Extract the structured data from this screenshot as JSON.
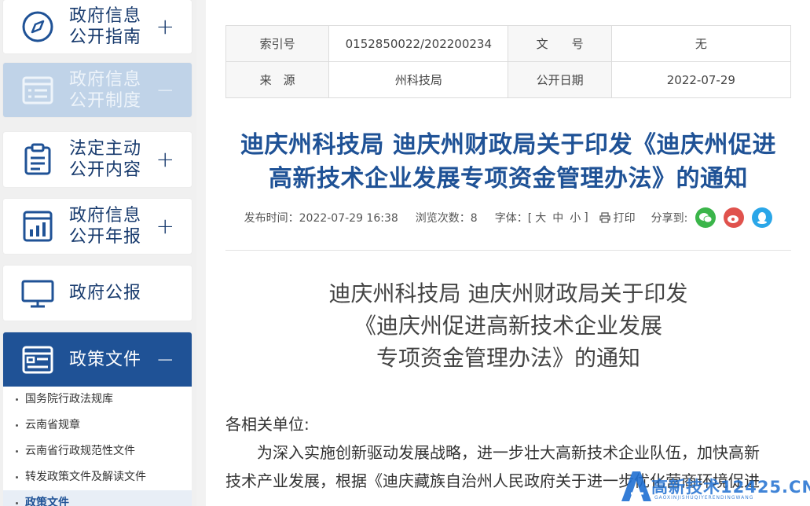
{
  "sidebar": {
    "items": [
      {
        "label": "政府信息公开指南",
        "toggle": "+",
        "icon": "compass-icon"
      },
      {
        "label": "政府信息公开制度",
        "toggle": "−",
        "icon": "list-doc-icon"
      },
      {
        "label": "法定主动公开内容",
        "toggle": "+",
        "icon": "clipboard-icon"
      },
      {
        "label": "政府信息公开年报",
        "toggle": "+",
        "icon": "bar-report-icon"
      },
      {
        "label": "政府公报",
        "toggle": "",
        "icon": "monitor-icon"
      },
      {
        "label": "政策文件",
        "toggle": "−",
        "icon": "policy-doc-icon"
      }
    ],
    "subitems": [
      "国务院行政法规库",
      "云南省规章",
      "云南省行政规范性文件",
      "转发政策文件及解读文件",
      "政策文件"
    ]
  },
  "meta": {
    "index_label": "索引号",
    "index_value": "0152850022/202200234",
    "docno_label": "文　　号",
    "docno_value": "无",
    "source_label": "来　源",
    "source_value": "州科技局",
    "date_label": "公开日期",
    "date_value": "2022-07-29"
  },
  "article": {
    "title_line1": "迪庆州科技局 迪庆州财政局关于印发《迪庆州促进",
    "title_line2": "高新技术企业发展专项资金管理办法》的通知",
    "publish_time": "发布时间：2022-07-29 16:38",
    "views": "浏览次数：8",
    "font_label": "字体：[",
    "font_large": "大",
    "font_medium": "中",
    "font_small": "小",
    "font_close": "]",
    "print_label": "打印",
    "share_label": "分享到:",
    "doc_title_line1": "迪庆州科技局 迪庆州财政局关于印发",
    "doc_title_line2": "《迪庆州促进高新技术企业发展",
    "doc_title_line3": "专项资金管理办法》的通知",
    "salutation": "各相关单位:",
    "para1": "为深入实施创新驱动发展战略，进一步壮大高新技术企业队伍，加快高新",
    "para2": "技术产业发展，根据《迪庆藏族自治州人民政府关于进一步优化营商环境促进"
  },
  "share": {
    "wechat_color": "#3bb54a",
    "weibo_color": "#e0524d",
    "qq_color": "#2aa6e8"
  },
  "watermark": {
    "brand": "高新技术12425.CN",
    "sub": "GAOXINJISHUQIYERENDINGWANG",
    "logo": "A"
  },
  "colors": {
    "accent": "#1f5296",
    "title": "#1f5296"
  }
}
